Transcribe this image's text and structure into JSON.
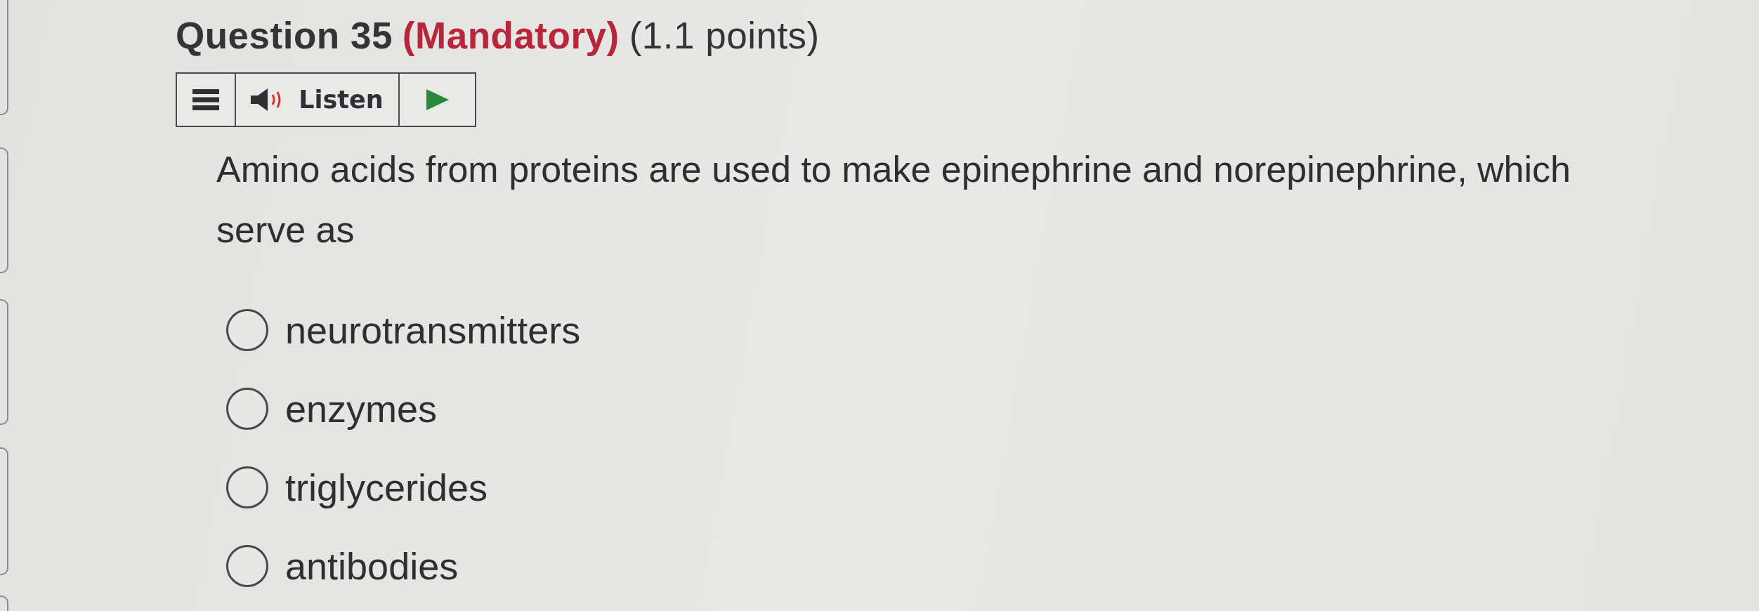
{
  "question": {
    "number": "Question 35",
    "mandatory": "(Mandatory)",
    "points": "(1.1 points)"
  },
  "toolbar": {
    "listen_label": "Listen"
  },
  "prompt": "Amino acids from proteins are used to make epinephrine and norepinephrine, which serve as",
  "options": [
    {
      "label": "neurotransmitters",
      "selected": false
    },
    {
      "label": "enzymes",
      "selected": false
    },
    {
      "label": "triglycerides",
      "selected": false
    },
    {
      "label": "antibodies",
      "selected": false
    }
  ]
}
